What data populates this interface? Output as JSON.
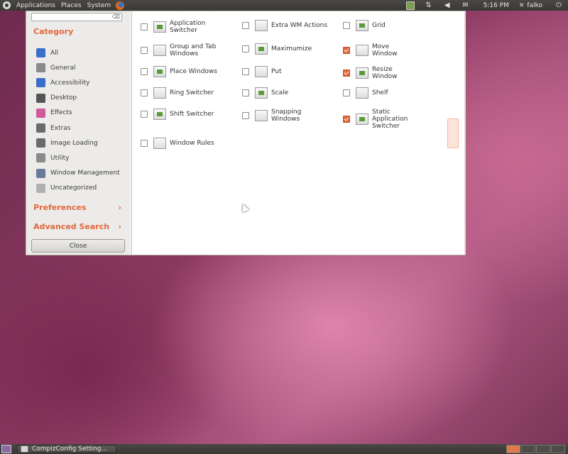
{
  "top_panel": {
    "menus": [
      "Applications",
      "Places",
      "System"
    ],
    "clock": "5:16 PM",
    "user": "falko"
  },
  "window": {
    "search": {
      "value": "",
      "placeholder": ""
    },
    "category_title": "Category",
    "categories": [
      {
        "label": "All",
        "icon": "globe-icon",
        "color": "#3a6ec8"
      },
      {
        "label": "General",
        "icon": "gear-icon",
        "color": "#8a8a8a"
      },
      {
        "label": "Accessibility",
        "icon": "accessibility-icon",
        "color": "#3a6ec8"
      },
      {
        "label": "Desktop",
        "icon": "desktop-icon",
        "color": "#555555"
      },
      {
        "label": "Effects",
        "icon": "effects-icon",
        "color": "#d05a9a"
      },
      {
        "label": "Extras",
        "icon": "extras-icon",
        "color": "#6a6a6a"
      },
      {
        "label": "Image Loading",
        "icon": "image-loading-icon",
        "color": "#6a6a6a"
      },
      {
        "label": "Utility",
        "icon": "utility-icon",
        "color": "#8a8a8a"
      },
      {
        "label": "Window Management",
        "icon": "window-management-icon",
        "color": "#6a7a9a"
      },
      {
        "label": "Uncategorized",
        "icon": "uncategorized-icon",
        "color": "#b0b0b0"
      }
    ],
    "preferences_label": "Preferences",
    "advanced_search_label": "Advanced Search",
    "close_label": "Close",
    "plugins": [
      {
        "label": "Application Switcher",
        "checked": false,
        "icon": "application-switcher-icon"
      },
      {
        "label": "Extra WM Actions",
        "checked": false,
        "icon": "extra-wm-actions-icon"
      },
      {
        "label": "Grid",
        "checked": false,
        "icon": "grid-icon"
      },
      {
        "label": "Group and Tab Windows",
        "checked": false,
        "icon": "group-and-tab-icon"
      },
      {
        "label": "Maximumize",
        "checked": false,
        "icon": "maximumize-icon"
      },
      {
        "label": "Move Window",
        "checked": true,
        "icon": "move-window-icon"
      },
      {
        "label": "Place Windows",
        "checked": false,
        "icon": "place-windows-icon"
      },
      {
        "label": "Put",
        "checked": false,
        "icon": "put-icon"
      },
      {
        "label": "Resize Window",
        "checked": true,
        "icon": "resize-window-icon"
      },
      {
        "label": "Ring Switcher",
        "checked": false,
        "icon": "ring-switcher-icon"
      },
      {
        "label": "Scale",
        "checked": false,
        "icon": "scale-icon"
      },
      {
        "label": "Shelf",
        "checked": false,
        "icon": "shelf-icon"
      },
      {
        "label": "Shift Switcher",
        "checked": false,
        "icon": "shift-switcher-icon"
      },
      {
        "label": "Snapping Windows",
        "checked": false,
        "icon": "snapping-windows-icon"
      },
      {
        "label": "Static Application Switcher",
        "checked": true,
        "icon": "static-application-switcher-icon"
      },
      {
        "label": "Window Rules",
        "checked": false,
        "icon": "window-rules-icon"
      }
    ]
  },
  "bottom_panel": {
    "task_label": "CompizConfig Setting..."
  }
}
